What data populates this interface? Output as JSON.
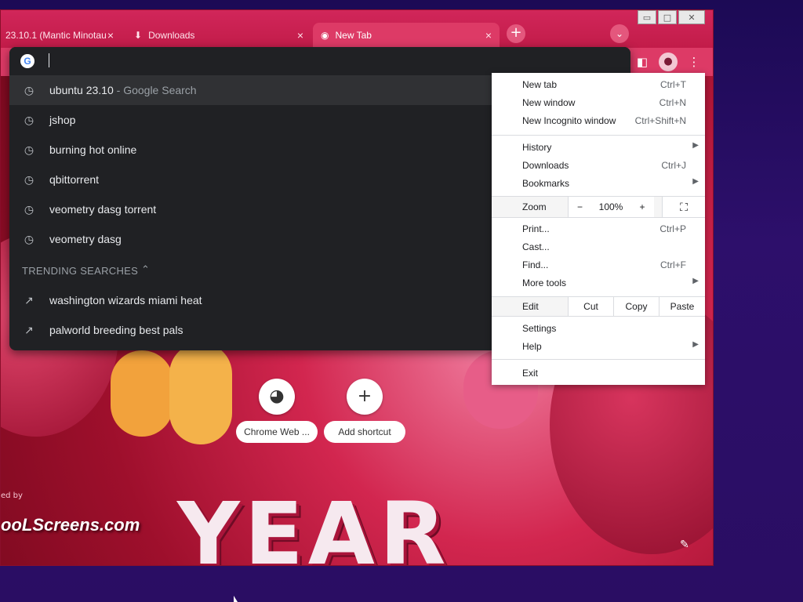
{
  "browser": {
    "tabs": [
      {
        "label": "23.10.1 (Mantic Minotau",
        "icon": "ubuntu-icon",
        "close": "×"
      },
      {
        "label": "Downloads",
        "icon": "download-icon",
        "close": "×"
      },
      {
        "label": "New Tab",
        "icon": "chrome-icon",
        "close": "×"
      }
    ],
    "new_tab_symbol": "+",
    "tab_search_symbol": "⌄",
    "window_controls": {
      "minimize": "▭",
      "maximize": "□",
      "close": "✕"
    }
  },
  "omnibox": {
    "input_value": "",
    "suggestions": [
      {
        "text": "ubuntu 23.10",
        "sub": " - Google Search",
        "icon": "history-icon"
      },
      {
        "text": "jshop",
        "sub": "",
        "icon": "history-icon"
      },
      {
        "text": "burning hot online",
        "sub": "",
        "icon": "history-icon"
      },
      {
        "text": "qbittorrent",
        "sub": "",
        "icon": "history-icon"
      },
      {
        "text": "veometry dasg torrent",
        "sub": "",
        "icon": "history-icon"
      },
      {
        "text": "veometry dasg",
        "sub": "",
        "icon": "history-icon"
      }
    ],
    "trending_header": "TRENDING SEARCHES",
    "trending": [
      {
        "text": "washington wizards miami heat",
        "icon": "trending-icon"
      },
      {
        "text": "palworld breeding best pals",
        "icon": "trending-icon"
      }
    ]
  },
  "menu": {
    "group1": [
      {
        "label": "New tab",
        "shortcut": "Ctrl+T"
      },
      {
        "label": "New window",
        "shortcut": "Ctrl+N"
      },
      {
        "label": "New Incognito window",
        "shortcut": "Ctrl+Shift+N"
      }
    ],
    "group2": [
      {
        "label": "History",
        "shortcut": ""
      },
      {
        "label": "Downloads",
        "shortcut": "Ctrl+J"
      },
      {
        "label": "Bookmarks",
        "shortcut": ""
      }
    ],
    "zoom": {
      "label": "Zoom",
      "minus": "−",
      "value": "100%",
      "plus": "+",
      "fullscreen": "⛶"
    },
    "group3": [
      {
        "label": "Print...",
        "shortcut": "Ctrl+P"
      },
      {
        "label": "Cast...",
        "shortcut": ""
      },
      {
        "label": "Find...",
        "shortcut": "Ctrl+F"
      },
      {
        "label": "More tools",
        "shortcut": ""
      }
    ],
    "edit": {
      "label": "Edit",
      "cut": "Cut",
      "copy": "Copy",
      "paste": "Paste"
    },
    "group4": [
      {
        "label": "Settings"
      },
      {
        "label": "Help"
      }
    ],
    "exit": "Exit"
  },
  "ntp": {
    "shortcuts": [
      {
        "label": "Chrome Web ...",
        "icon": "chrome-web-store-icon"
      },
      {
        "label": "Add shortcut",
        "icon": "plus-icon",
        "symbol": "+"
      }
    ],
    "background_title_fragment": "YEAR",
    "attribution_prefix": "ed by",
    "attribution_site": "ooLScreens.com"
  }
}
